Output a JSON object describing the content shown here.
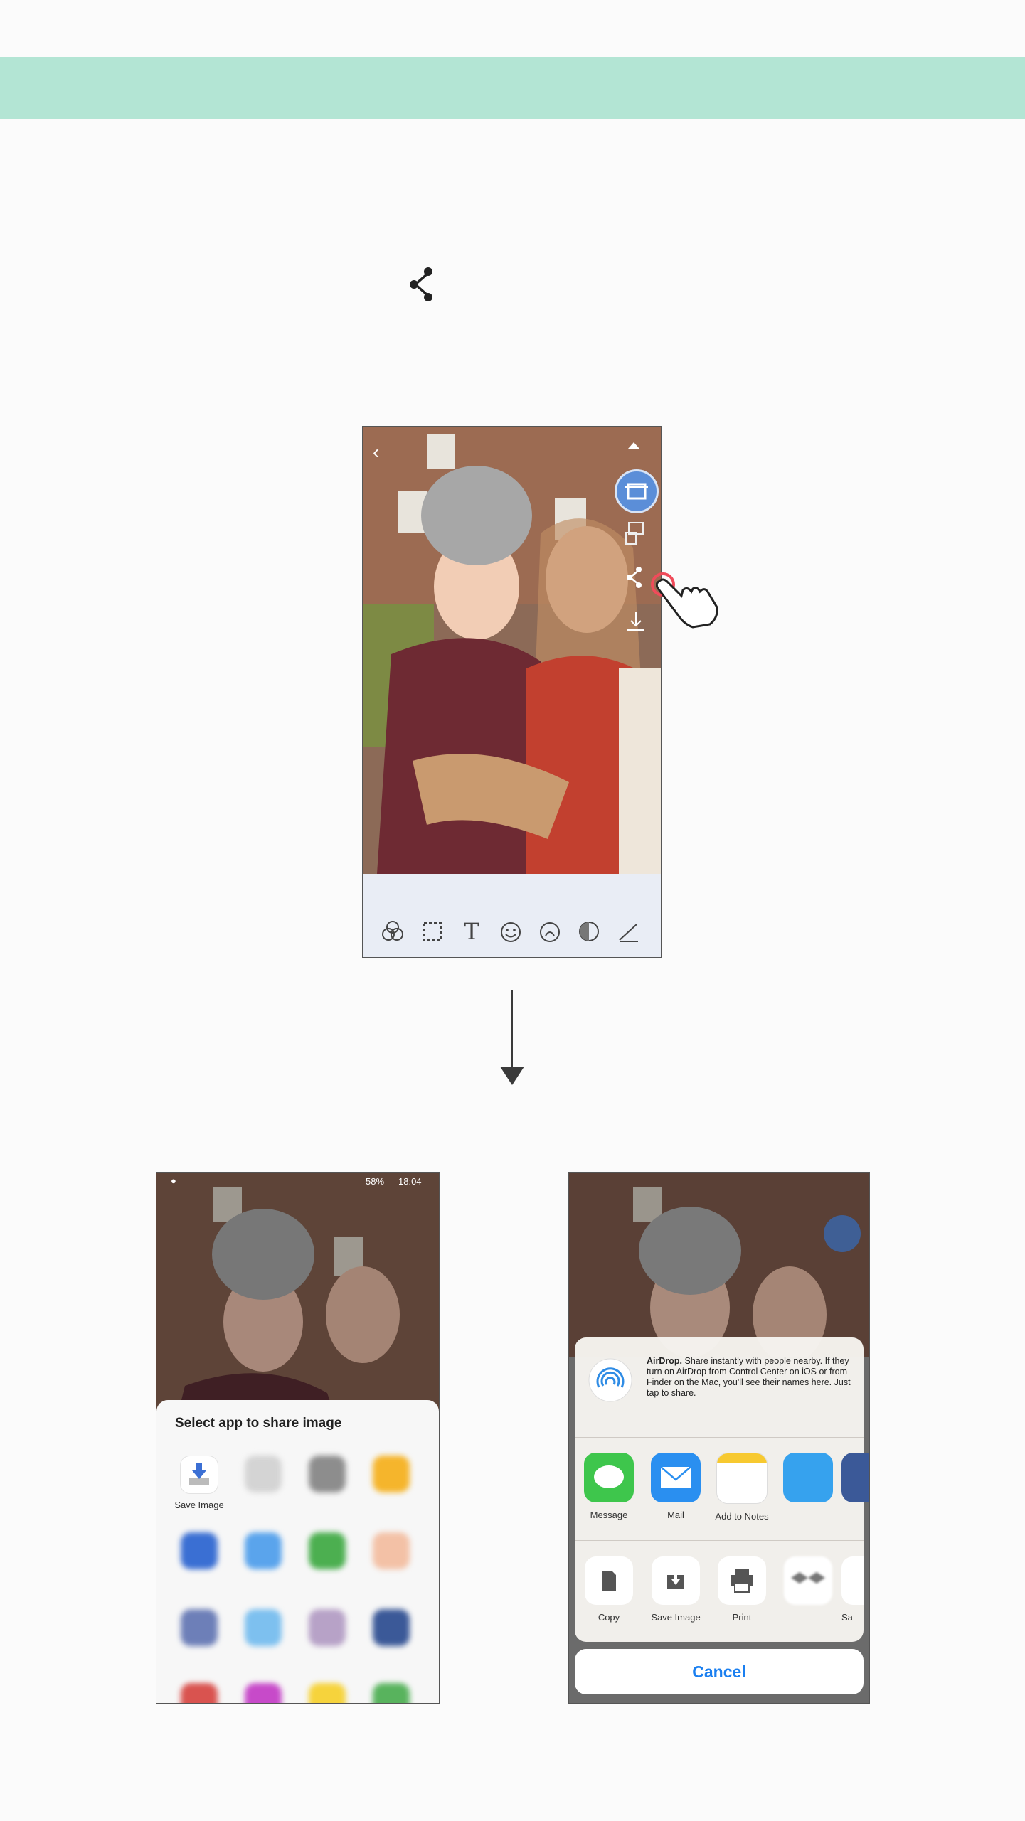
{
  "share_glyph": "share-icon",
  "colors": {
    "band": "#b3e5d4",
    "accent_blue": "#1a7ff0",
    "tap_red": "#f04b5a"
  },
  "main_phone": {
    "side_icons": [
      "chevron-up-icon",
      "print-icon",
      "collage-icon",
      "share-icon",
      "download-icon"
    ],
    "tools": [
      "filter-icon",
      "crop-icon",
      "text-icon",
      "sticker-icon",
      "sticker-alt-icon",
      "contrast-icon",
      "draw-icon"
    ],
    "text_tool": "T"
  },
  "android": {
    "status_time": "18:04",
    "status_battery": "58%",
    "sheet_title": "Select app to share image",
    "first_app_label": "Save Image"
  },
  "ios": {
    "airdrop_bold": "AirDrop.",
    "airdrop_text": "Share instantly with people nearby. If they turn on AirDrop from Control Center on iOS or from Finder on the Mac, you'll see their names here. Just tap to share.",
    "apps": [
      "Message",
      "Mail",
      "Add to Notes"
    ],
    "actions": [
      "Copy",
      "Save Image",
      "Print"
    ],
    "action_partial": "Sa",
    "cancel_label": "Cancel"
  }
}
